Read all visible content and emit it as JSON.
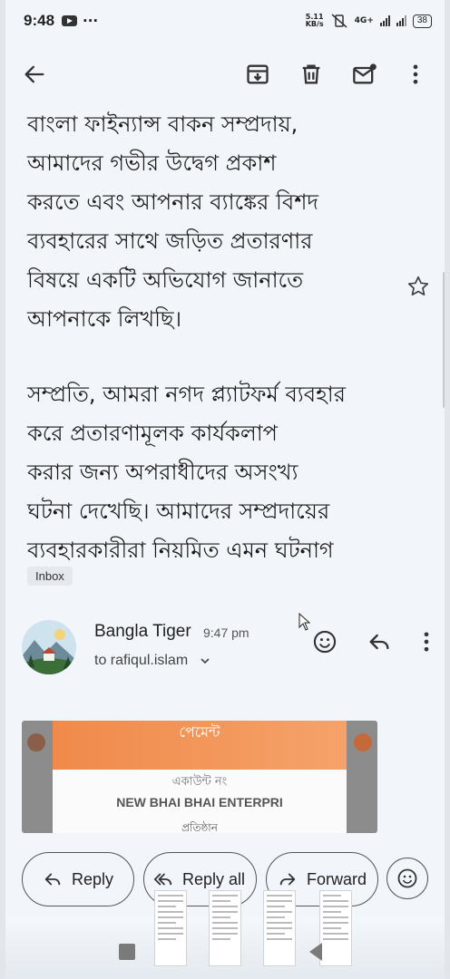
{
  "status_bar": {
    "time": "9:48",
    "more": "···",
    "speed_value": "5.11",
    "speed_unit": "KB/s",
    "network": "4G+",
    "battery": "38"
  },
  "toolbar": {
    "back_icon": "arrow-left-icon",
    "archive_icon": "archive-icon",
    "delete_icon": "trash-icon",
    "mark_unread_icon": "mail-badge-icon",
    "more_icon": "more-vert-icon"
  },
  "message": {
    "paragraph1": [
      "বাংলা ফাইন্যান্স বাকন সম্প্রদায়,",
      "আমাদের গভীর উদ্বেগ প্রকাশ",
      "করতে এবং আপনার ব্যাঙ্কের বিশদ",
      "ব্যবহারের সাথে জড়িত প্রতারণার",
      "বিষয়ে একটি অভিযোগ জানাতে",
      "আপনাকে লিখছি।"
    ],
    "paragraph2": [
      "সম্প্রতি, আমরা নগদ প্ল্যাটফর্ম ব্যবহার",
      "করে প্রতারণামূলক কার্যকলাপ",
      "করার জন্য অপরাধীদের অসংখ্য",
      "ঘটনা দেখেছি। আমাদের সম্প্রদায়ের",
      "ব্যবহারকারীরা নিয়মিত এমন ঘটনাগ"
    ],
    "label": "Inbox"
  },
  "sender": {
    "name": "Bangla Tiger",
    "time": "9:47 pm",
    "to": "to rafiqul.islam"
  },
  "attachment": {
    "header": "পেমেন্ট",
    "account_label": "একাউন্ট নং",
    "account_name": "NEW BHAI BHAI ENTERPRI",
    "sub": "প্রতিষ্ঠান"
  },
  "actions": {
    "reply": "Reply",
    "reply_all": "Reply all",
    "forward": "Forward"
  },
  "colors": {
    "background": "#f2f6fb",
    "attachment_orange": "#f08a4a"
  }
}
